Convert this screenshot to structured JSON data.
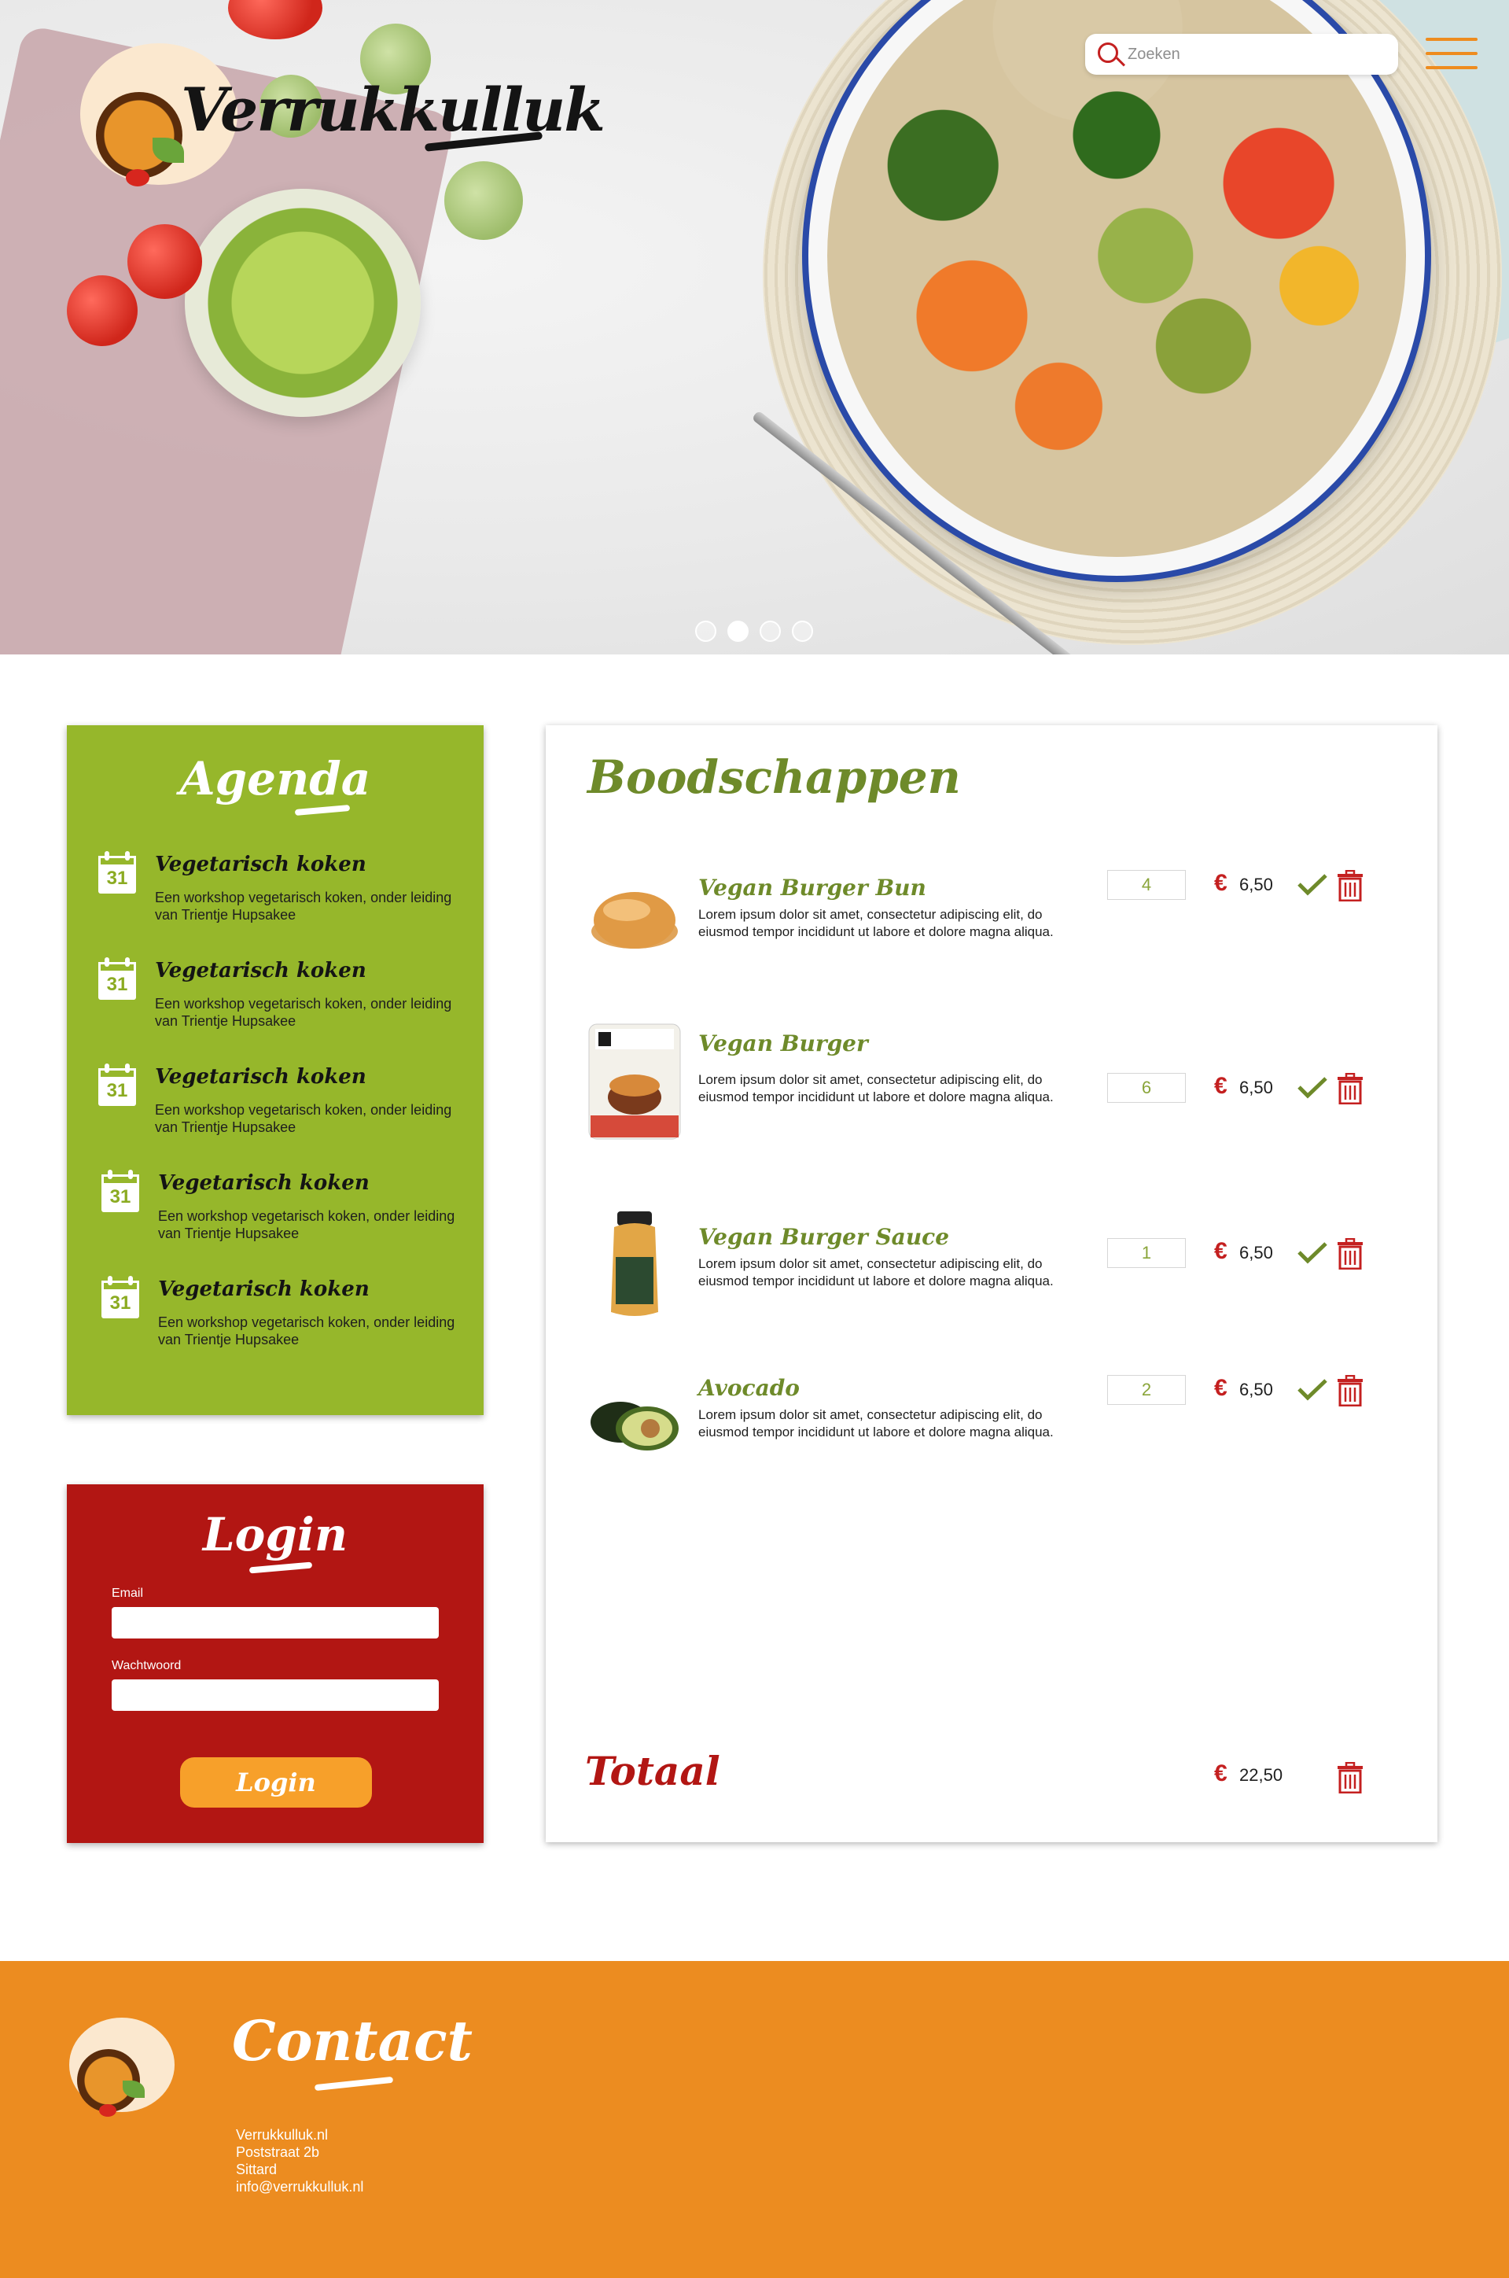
{
  "brand": {
    "name": "Verrukkulluk"
  },
  "search": {
    "placeholder": "Zoeken"
  },
  "hero": {
    "slides": 4,
    "active_slide": 2
  },
  "agenda": {
    "title": "Agenda",
    "items": [
      {
        "day": "31",
        "title": "Vegetarisch koken",
        "description": "Een workshop vegetarisch koken, onder leiding van Trientje Hupsakee"
      },
      {
        "day": "31",
        "title": "Vegetarisch koken",
        "description": "Een workshop vegetarisch koken, onder leiding van Trientje Hupsakee"
      },
      {
        "day": "31",
        "title": "Vegetarisch koken",
        "description": "Een workshop vegetarisch koken, onder leiding van Trientje Hupsakee"
      },
      {
        "day": "31",
        "title": "Vegetarisch koken",
        "description": "Een workshop vegetarisch koken, onder leiding van Trientje Hupsakee"
      },
      {
        "day": "31",
        "title": "Vegetarisch koken",
        "description": "Een workshop vegetarisch koken, onder leiding van Trientje Hupsakee"
      }
    ]
  },
  "login": {
    "title": "Login",
    "email_label": "Email",
    "password_label": "Wachtwoord",
    "button_label": "Login"
  },
  "cart": {
    "title": "Boodschappen",
    "currency_symbol": "€",
    "items": [
      {
        "name": "Vegan Burger Bun",
        "description": "Lorem ipsum dolor sit amet, consectetur adipiscing elit, do eiusmod tempor incididunt ut labore et dolore magna aliqua.",
        "quantity": "4",
        "price": "6,50",
        "image": "burger-bun-image"
      },
      {
        "name": "Vegan Burger",
        "description": "Lorem ipsum dolor sit amet, consectetur adipiscing elit, do eiusmod tempor incididunt ut labore et dolore magna aliqua.",
        "quantity": "6",
        "price": "6,50",
        "image": "vegan-burger-package-image"
      },
      {
        "name": "Vegan Burger Sauce",
        "description": "Lorem ipsum dolor sit amet, consectetur adipiscing elit, do eiusmod tempor incididunt ut labore et dolore magna aliqua.",
        "quantity": "1",
        "price": "6,50",
        "image": "sauce-bottle-image"
      },
      {
        "name": "Avocado",
        "description": "Lorem ipsum dolor sit amet, consectetur adipiscing elit, do eiusmod tempor incididunt ut labore et dolore magna aliqua.",
        "quantity": "2",
        "price": "6,50",
        "image": "avocado-image"
      }
    ],
    "total_label": "Totaal",
    "total_price": "22,50"
  },
  "footer": {
    "title": "Contact",
    "lines": [
      "Verrukkulluk.nl",
      "Poststraat 2b",
      "Sittard",
      "info@verrukkulluk.nl"
    ]
  },
  "colors": {
    "agenda_green": "#96b72b",
    "login_red": "#b21613",
    "footer_orange": "#ec8c20",
    "accent_green": "#6e8a2a",
    "button_orange": "#f7a02a"
  }
}
